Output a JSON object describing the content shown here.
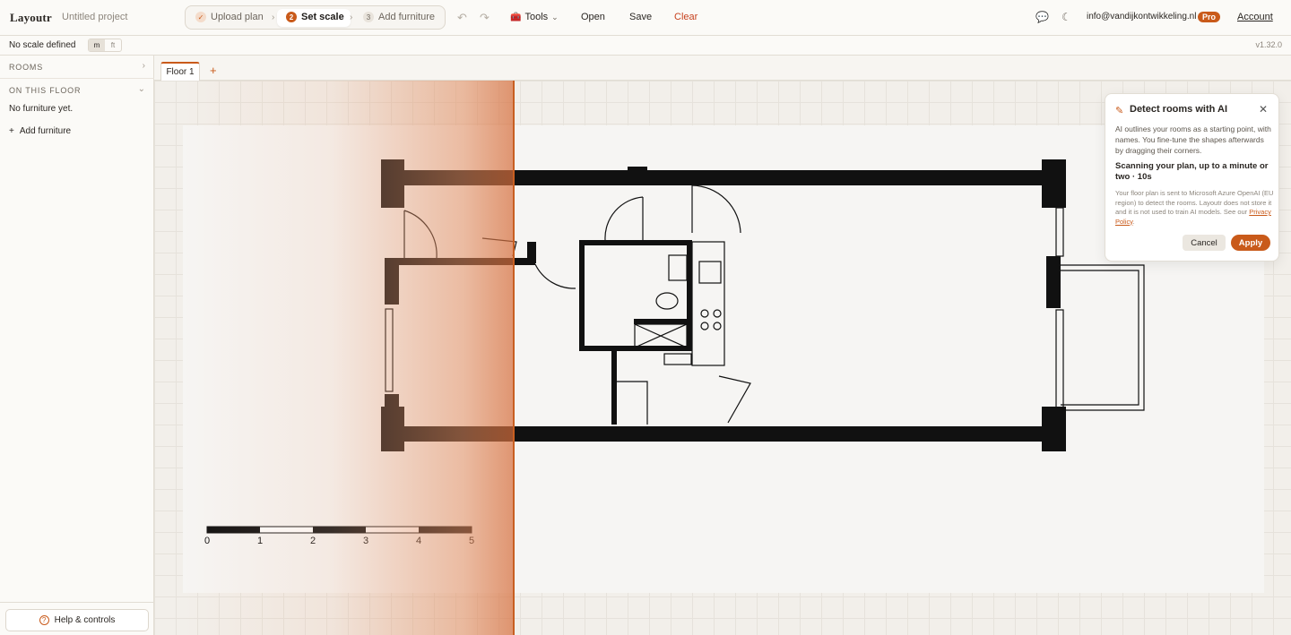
{
  "app": {
    "name": "Layoutr",
    "project": "Untitled project"
  },
  "steps": [
    {
      "num": "✓",
      "label": "Upload plan",
      "state": "done"
    },
    {
      "num": "2",
      "label": "Set scale",
      "state": "active"
    },
    {
      "num": "3",
      "label": "Add furniture",
      "state": "pending"
    }
  ],
  "toolbar": {
    "tools": "Tools",
    "open": "Open",
    "save": "Save",
    "clear": "Clear"
  },
  "user": {
    "email": "info@vandijkontwikkeling.nl",
    "badge": "Pro",
    "account": "Account"
  },
  "scale": {
    "status": "No scale defined",
    "unit_m": "m",
    "unit_ft": "ft",
    "selected_unit": "m"
  },
  "version": "v1.32.0",
  "sidebar": {
    "rooms_title": "ROOMS",
    "floor_title": "ON THIS FLOOR",
    "empty": "No furniture yet.",
    "add_furniture": "Add furniture",
    "help": "Help & controls"
  },
  "tabs": [
    {
      "label": "Floor 1"
    }
  ],
  "plan": {
    "scale_labels": [
      "0",
      "1",
      "2",
      "3",
      "4",
      "5"
    ]
  },
  "ai_panel": {
    "title": "Detect rooms with AI",
    "description": "AI outlines your rooms as a starting point, with names. You fine-tune the shapes afterwards by dragging their corners.",
    "status": "Scanning your plan, up to a minute or two · 10s",
    "privacy_text": "Your floor plan is sent to Microsoft Azure OpenAI (EU region) to detect the rooms. Layoutr does not store it and it is not used to train AI models. See our ",
    "privacy_link": "Privacy Policy",
    "privacy_end": ".",
    "cancel": "Cancel",
    "apply": "Apply"
  },
  "colors": {
    "accent": "#c95a1a",
    "clear": "#c7421f"
  }
}
